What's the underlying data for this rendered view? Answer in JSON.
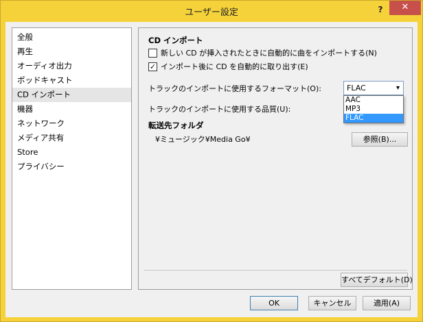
{
  "window": {
    "title": "ユーザー設定",
    "help_label": "?",
    "close_label": "✕"
  },
  "sidebar": {
    "items": [
      {
        "label": "全般"
      },
      {
        "label": "再生"
      },
      {
        "label": "オーディオ出力"
      },
      {
        "label": "ポッドキャスト"
      },
      {
        "label": "CD インポート",
        "selected": true
      },
      {
        "label": "機器"
      },
      {
        "label": "ネットワーク"
      },
      {
        "label": "メディア共有"
      },
      {
        "label": "Store"
      },
      {
        "label": "プライバシー"
      }
    ]
  },
  "panel": {
    "heading": "CD インポート",
    "auto_import_label": "新しい CD が挿入されたときに自動的に曲をインポートする(N)",
    "auto_import_checked": false,
    "auto_eject_label": "インポート後に CD を自動的に取り出す(E)",
    "auto_eject_checked": true,
    "format_label": "トラックのインポートに使用するフォーマット(O):",
    "format_value": "FLAC",
    "format_options": [
      "AAC",
      "MP3",
      "FLAC"
    ],
    "quality_label": "トラックのインポートに使用する品質(U):",
    "dest_heading": "転送先フォルダ",
    "dest_path": "¥ミュージック¥Media Go¥",
    "browse_label": "参照(B)...",
    "defaults_label": "すべてデフォルト(D)"
  },
  "footer": {
    "ok_label": "OK",
    "cancel_label": "キャンセル",
    "apply_label": "適用(A)"
  },
  "colors": {
    "title_bar": "#f6d23a",
    "close_button": "#c7504a",
    "selection": "#3399ff"
  }
}
